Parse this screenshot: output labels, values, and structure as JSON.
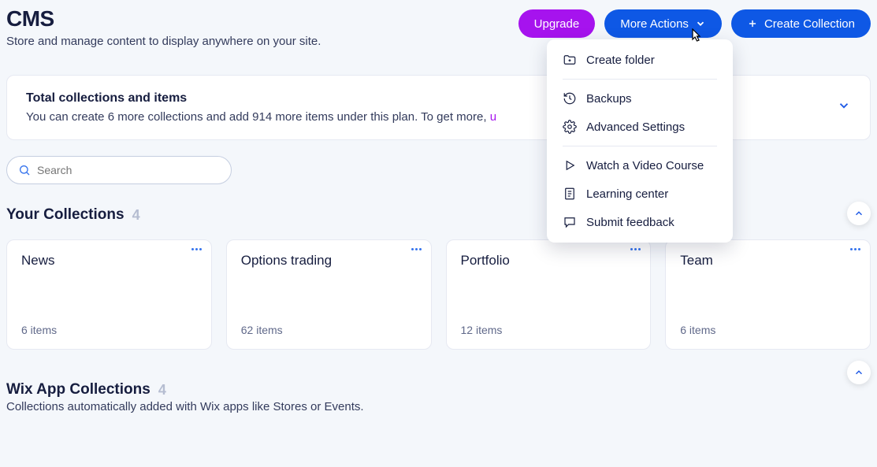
{
  "header": {
    "title": "CMS",
    "subtitle": "Store and manage content to display anywhere on your site.",
    "upgrade_label": "Upgrade",
    "more_actions_label": "More Actions",
    "create_collection_label": "Create Collection"
  },
  "dropdown": {
    "items": [
      {
        "label": "Create folder"
      },
      {
        "label": "Backups"
      },
      {
        "label": "Advanced Settings"
      },
      {
        "label": "Watch a Video Course"
      },
      {
        "label": "Learning center"
      },
      {
        "label": "Submit feedback"
      }
    ]
  },
  "banner": {
    "title": "Total collections and items",
    "body": "You can create 6 more collections and add 914 more items under this plan. To get more, ",
    "link_prefix": "u"
  },
  "search": {
    "placeholder": "Search"
  },
  "your_collections": {
    "title": "Your Collections",
    "count": "4",
    "cards": [
      {
        "title": "News",
        "items": "6 items"
      },
      {
        "title": "Options trading",
        "items": "62 items"
      },
      {
        "title": "Portfolio",
        "items": "12 items"
      },
      {
        "title": "Team",
        "items": "6 items"
      }
    ]
  },
  "wix_collections": {
    "title": "Wix App Collections",
    "count": "4",
    "subtitle": "Collections automatically added with Wix apps like Stores or Events."
  }
}
